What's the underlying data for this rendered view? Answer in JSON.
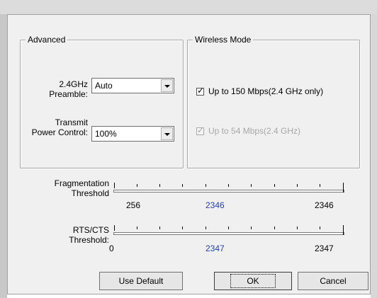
{
  "advanced": {
    "title": "Advanced",
    "preamble_label_1": "2.4GHz",
    "preamble_label_2": "Preamble:",
    "preamble_value": "Auto",
    "power_label_1": "Transmit",
    "power_label_2": "Power Control:",
    "power_value": "100%"
  },
  "wireless_mode": {
    "title": "Wireless Mode",
    "options": [
      {
        "label": "Up to 150 Mbps(2.4 GHz only)",
        "checked": true,
        "enabled": true
      },
      {
        "label": "Up to 54 Mbps(2.4 GHz)",
        "checked": true,
        "enabled": false
      }
    ]
  },
  "fragmentation": {
    "label_1": "Fragmentation",
    "label_2": "Threshold",
    "min": "256",
    "current": "2346",
    "max": "2346",
    "value": 2346,
    "range": [
      256,
      2346
    ]
  },
  "rts_cts": {
    "label_1": "RTS/CTS",
    "label_2": "Threshold:",
    "min": "0",
    "current": "2347",
    "max": "2347",
    "value": 2347,
    "range": [
      0,
      2347
    ]
  },
  "buttons": {
    "use_default": "Use Default",
    "ok": "OK",
    "cancel": "Cancel"
  },
  "colors": {
    "current_value": "#1f3fc0",
    "disabled_text": "#a8a8a8"
  }
}
